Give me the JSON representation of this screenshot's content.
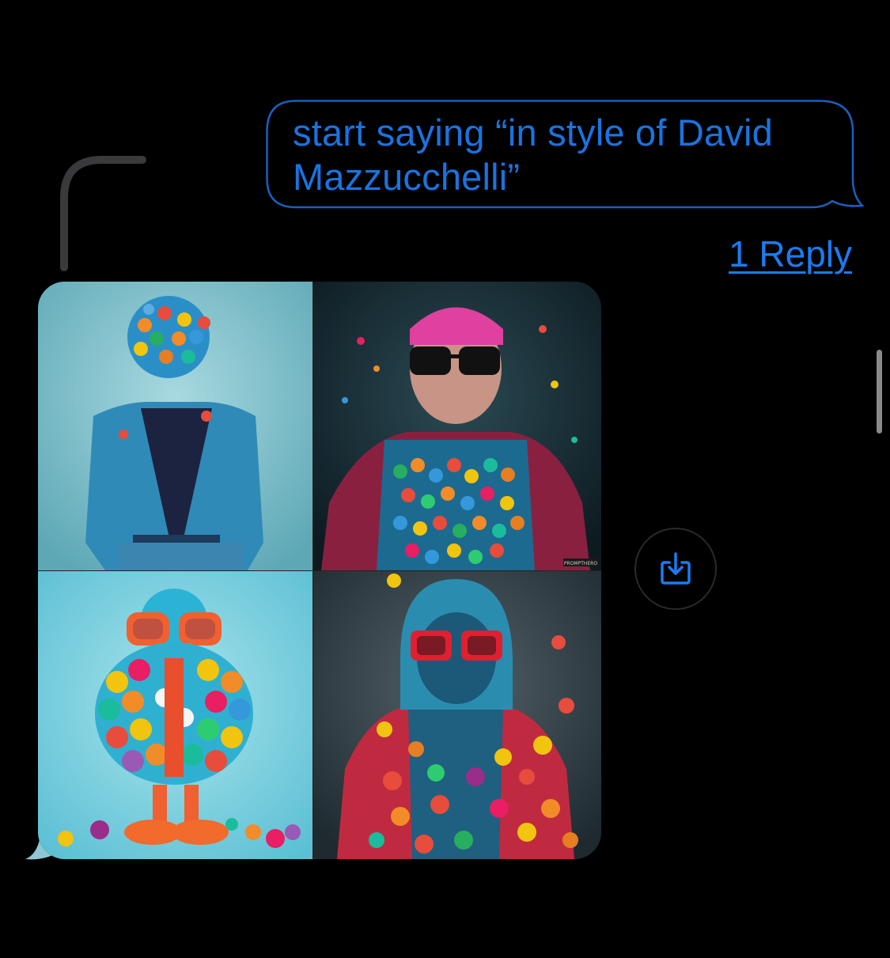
{
  "message_out": {
    "text_line1": "start saying “in style of David",
    "text_line2": "Mazzucchelli”"
  },
  "thread": {
    "reply_label": "1 Reply"
  },
  "image_message": {
    "tiles": [
      {
        "description_name": "blue-jacket-gumball-head"
      },
      {
        "description_name": "sunglasses-man-gumball-shirt"
      },
      {
        "description_name": "orange-glasses-gumball-character"
      },
      {
        "description_name": "hooded-red-glasses-figure"
      }
    ],
    "watermark_tile2": "PROMPTHERO"
  },
  "icons": {
    "save": "save-to-device-icon"
  },
  "colors": {
    "accent": "#1a7cf2",
    "bubble_border": "#1a5fc0",
    "background": "#000000"
  }
}
